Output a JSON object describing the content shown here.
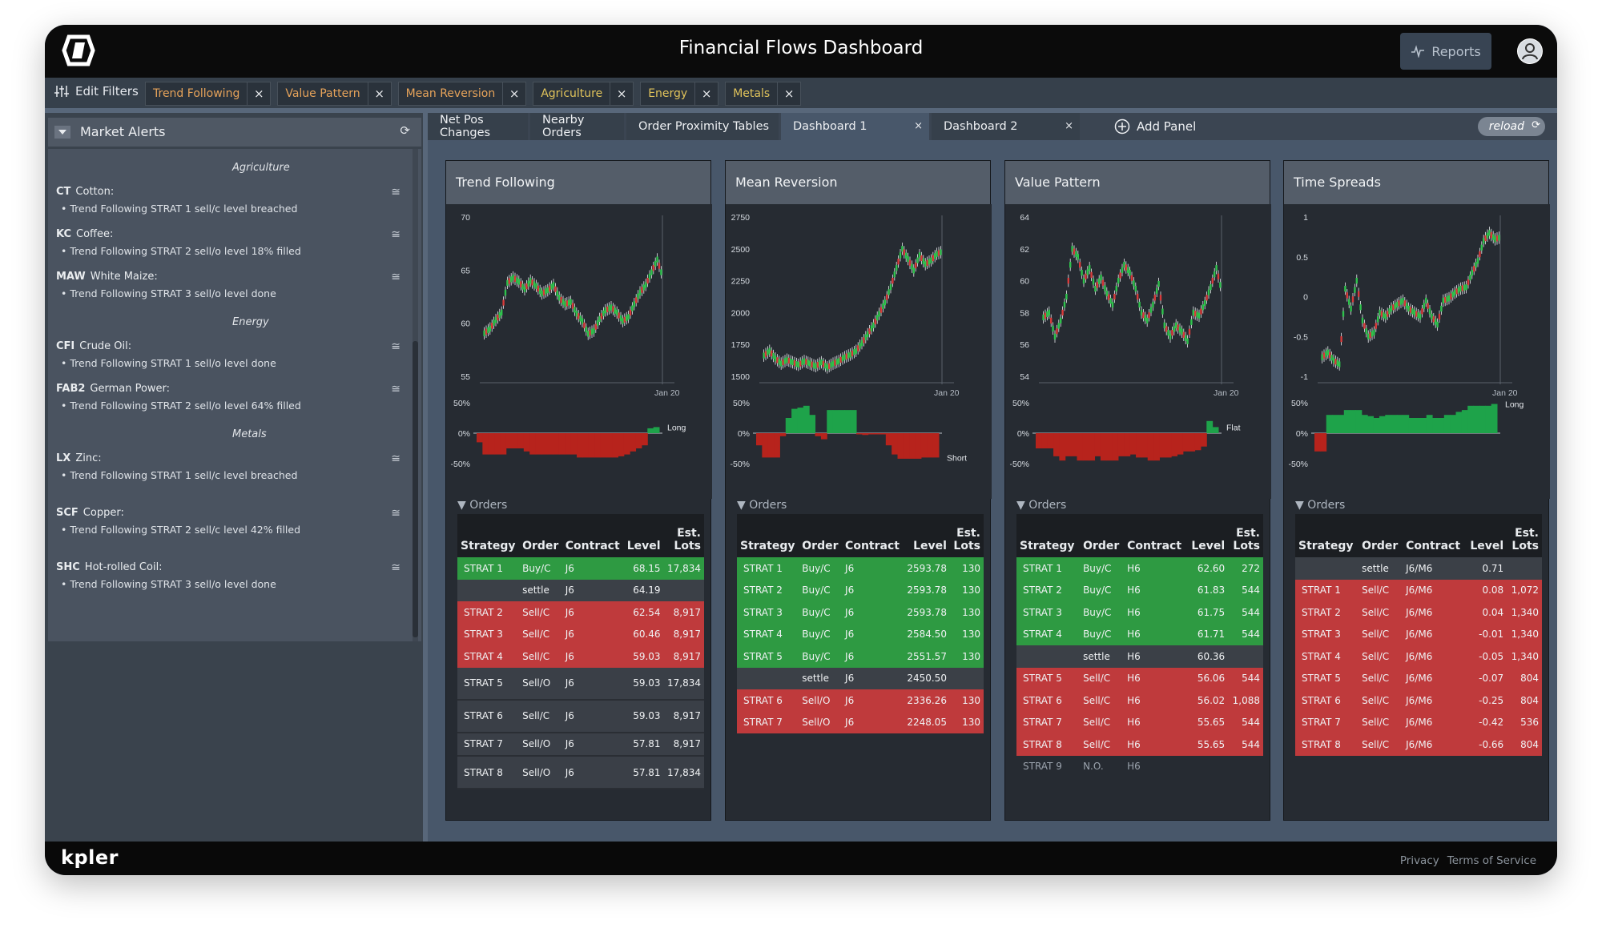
{
  "app": {
    "title": "Financial Flows Dashboard",
    "reports_label": "Reports"
  },
  "filters": {
    "edit_label": "Edit Filters",
    "chips": [
      {
        "label": "Trend Following",
        "color": "#e6a35a"
      },
      {
        "label": "Value Pattern",
        "color": "#e6a35a"
      },
      {
        "label": "Mean Reversion",
        "color": "#e6a35a"
      },
      {
        "label": "Agriculture",
        "color": "#e0c35b"
      },
      {
        "label": "Energy",
        "color": "#e0c35b"
      },
      {
        "label": "Metals",
        "color": "#e0c35b"
      }
    ],
    "remove_symbol": "×"
  },
  "sidebar": {
    "title": "Market Alerts",
    "sections": [
      {
        "name": "Agriculture",
        "alerts": [
          {
            "code": "CT",
            "name": "Cotton:",
            "msg": "Trend Following STRAT 1 sell/c level breached"
          },
          {
            "code": "KC",
            "name": "Coffee:",
            "msg": "Trend Following STRAT 2 sell/o level 18% filled"
          },
          {
            "code": "MAW",
            "name": "White Maize:",
            "msg": "Trend Following STRAT 3 sell/o level done"
          }
        ]
      },
      {
        "name": "Energy",
        "alerts": [
          {
            "code": "CFI",
            "name": "Crude Oil:",
            "msg": "Trend Following STRAT 1 sell/o level done"
          },
          {
            "code": "FAB2",
            "name": "German Power:",
            "msg": "Trend Following STRAT 2 sell/o level 64% filled"
          }
        ]
      },
      {
        "name": "Metals",
        "alerts": [
          {
            "code": "LX",
            "name": "Zinc:",
            "msg": "Trend Following STRAT 1 sell/c level breached"
          },
          {
            "code": "SCF",
            "name": "Copper:",
            "msg": "Trend Following STRAT 2 sell/c level 42% filled"
          },
          {
            "code": "SHC",
            "name": "Hot-rolled Coil:",
            "msg": "Trend Following STRAT 3 sell/o level done"
          }
        ]
      }
    ]
  },
  "tabs": {
    "items": [
      "Net Pos Changes",
      "Nearby Orders",
      "Order Proximity Tables",
      "Dashboard 1",
      "Dashboard 2"
    ],
    "active": "Dashboard 1",
    "add_label": "Add Panel",
    "reload_label": "reload"
  },
  "columns": {
    "strategy": "Strategy",
    "order": "Order",
    "contract": "Contract",
    "level": "Level",
    "lots_top": "Est.",
    "lots_bottom": "Lots"
  },
  "orders_label": "Orders",
  "panels": [
    {
      "title": "Trend Following",
      "chart": {
        "y_ticks": [
          "70",
          "65",
          "60",
          "55"
        ],
        "y_min": 55,
        "y_max": 70,
        "date_label": "Jan 20"
      },
      "position": {
        "ticks": [
          "50%",
          "0%",
          "-50%"
        ],
        "label": "Long"
      },
      "orders": [
        {
          "strategy": "STRAT 1",
          "order": "Buy/C",
          "contract": "J6",
          "level": "68.15",
          "lots": "17,834",
          "type": "buy"
        },
        {
          "strategy": "",
          "order": "settle",
          "contract": "J6",
          "level": "64.19",
          "lots": "",
          "type": "settle"
        },
        {
          "strategy": "STRAT 2",
          "order": "Sell/C",
          "contract": "J6",
          "level": "62.54",
          "lots": "8,917",
          "type": "sell"
        },
        {
          "strategy": "STRAT 3",
          "order": "Sell/C",
          "contract": "J6",
          "level": "60.46",
          "lots": "8,917",
          "type": "sell"
        },
        {
          "strategy": "STRAT 4",
          "order": "Sell/C",
          "contract": "J6",
          "level": "59.03",
          "lots": "8,917",
          "type": "sell"
        },
        {
          "strategy": "STRAT 5",
          "order": "Sell/O",
          "contract": "J6",
          "level": "59.03",
          "lots": "17,834",
          "type": "dark-tall"
        },
        {
          "strategy": "STRAT 6",
          "order": "Sell/C",
          "contract": "J6",
          "level": "59.03",
          "lots": "8,917",
          "type": "dark-tall"
        },
        {
          "strategy": "STRAT 7",
          "order": "Sell/O",
          "contract": "J6",
          "level": "57.81",
          "lots": "8,917",
          "type": "dark"
        },
        {
          "strategy": "STRAT 8",
          "order": "Sell/O",
          "contract": "J6",
          "level": "57.81",
          "lots": "17,834",
          "type": "dark-tall"
        }
      ]
    },
    {
      "title": "Mean Reversion",
      "chart": {
        "y_ticks": [
          "2750",
          "2500",
          "2250",
          "2000",
          "1750",
          "1500"
        ],
        "y_min": 1500,
        "y_max": 2750,
        "date_label": "Jan 20"
      },
      "position": {
        "ticks": [
          "50%",
          "0%",
          "-50%"
        ],
        "label": "Short"
      },
      "orders": [
        {
          "strategy": "STRAT 1",
          "order": "Buy/C",
          "contract": "J6",
          "level": "2593.78",
          "lots": "130",
          "type": "buy"
        },
        {
          "strategy": "STRAT 2",
          "order": "Buy/C",
          "contract": "J6",
          "level": "2593.78",
          "lots": "130",
          "type": "buy"
        },
        {
          "strategy": "STRAT 3",
          "order": "Buy/C",
          "contract": "J6",
          "level": "2593.78",
          "lots": "130",
          "type": "buy"
        },
        {
          "strategy": "STRAT 4",
          "order": "Buy/C",
          "contract": "J6",
          "level": "2584.50",
          "lots": "130",
          "type": "buy"
        },
        {
          "strategy": "STRAT 5",
          "order": "Buy/C",
          "contract": "J6",
          "level": "2551.57",
          "lots": "130",
          "type": "buy"
        },
        {
          "strategy": "",
          "order": "settle",
          "contract": "J6",
          "level": "2450.50",
          "lots": "",
          "type": "settle"
        },
        {
          "strategy": "STRAT 6",
          "order": "Sell/O",
          "contract": "J6",
          "level": "2336.26",
          "lots": "130",
          "type": "sell"
        },
        {
          "strategy": "STRAT 7",
          "order": "Sell/O",
          "contract": "J6",
          "level": "2248.05",
          "lots": "130",
          "type": "sell"
        }
      ]
    },
    {
      "title": "Value Pattern",
      "chart": {
        "y_ticks": [
          "64",
          "62",
          "60",
          "58",
          "56",
          "54"
        ],
        "y_min": 54,
        "y_max": 64,
        "date_label": "Jan 20"
      },
      "position": {
        "ticks": [
          "50%",
          "0%",
          "-50%"
        ],
        "label": "Flat"
      },
      "orders": [
        {
          "strategy": "STRAT 1",
          "order": "Buy/C",
          "contract": "H6",
          "level": "62.60",
          "lots": "272",
          "type": "buy"
        },
        {
          "strategy": "STRAT 2",
          "order": "Buy/C",
          "contract": "H6",
          "level": "61.83",
          "lots": "544",
          "type": "buy"
        },
        {
          "strategy": "STRAT 3",
          "order": "Buy/C",
          "contract": "H6",
          "level": "61.75",
          "lots": "544",
          "type": "buy"
        },
        {
          "strategy": "STRAT 4",
          "order": "Buy/C",
          "contract": "H6",
          "level": "61.71",
          "lots": "544",
          "type": "buy"
        },
        {
          "strategy": "",
          "order": "settle",
          "contract": "H6",
          "level": "60.36",
          "lots": "",
          "type": "settle"
        },
        {
          "strategy": "STRAT 5",
          "order": "Sell/C",
          "contract": "H6",
          "level": "56.06",
          "lots": "544",
          "type": "sell"
        },
        {
          "strategy": "STRAT 6",
          "order": "Sell/C",
          "contract": "H6",
          "level": "56.02",
          "lots": "1,088",
          "type": "sell"
        },
        {
          "strategy": "STRAT 7",
          "order": "Sell/C",
          "contract": "H6",
          "level": "55.65",
          "lots": "544",
          "type": "sell"
        },
        {
          "strategy": "STRAT 8",
          "order": "Sell/C",
          "contract": "H6",
          "level": "55.65",
          "lots": "544",
          "type": "sell"
        },
        {
          "strategy": "STRAT 9",
          "order": "N.O.",
          "contract": "H6",
          "level": "",
          "lots": "",
          "type": "plain"
        }
      ]
    },
    {
      "title": "Time Spreads",
      "chart": {
        "y_ticks": [
          "1",
          "0.5",
          "0",
          "-0.5",
          "-1"
        ],
        "y_min": -1,
        "y_max": 1,
        "date_label": "Jan 20"
      },
      "position": {
        "ticks": [
          "50%",
          "0%",
          "-50%"
        ],
        "label": "Long"
      },
      "orders": [
        {
          "strategy": "",
          "order": "settle",
          "contract": "J6/M6",
          "level": "0.71",
          "lots": "",
          "type": "settle"
        },
        {
          "strategy": "STRAT 1",
          "order": "Sell/C",
          "contract": "J6/M6",
          "level": "0.08",
          "lots": "1,072",
          "type": "sell"
        },
        {
          "strategy": "STRAT 2",
          "order": "Sell/C",
          "contract": "J6/M6",
          "level": "0.04",
          "lots": "1,340",
          "type": "sell"
        },
        {
          "strategy": "STRAT 3",
          "order": "Sell/C",
          "contract": "J6/M6",
          "level": "-0.01",
          "lots": "1,340",
          "type": "sell"
        },
        {
          "strategy": "STRAT 4",
          "order": "Sell/C",
          "contract": "J6/M6",
          "level": "-0.05",
          "lots": "1,340",
          "type": "sell"
        },
        {
          "strategy": "STRAT 5",
          "order": "Sell/C",
          "contract": "J6/M6",
          "level": "-0.07",
          "lots": "804",
          "type": "sell"
        },
        {
          "strategy": "STRAT 6",
          "order": "Sell/C",
          "contract": "J6/M6",
          "level": "-0.25",
          "lots": "804",
          "type": "sell"
        },
        {
          "strategy": "STRAT 7",
          "order": "Sell/C",
          "contract": "J6/M6",
          "level": "-0.42",
          "lots": "536",
          "type": "sell"
        },
        {
          "strategy": "STRAT 8",
          "order": "Sell/C",
          "contract": "J6/M6",
          "level": "-0.66",
          "lots": "804",
          "type": "sell"
        }
      ]
    }
  ],
  "chart_data": [
    {
      "type": "line",
      "title": "Trend Following",
      "x_label": "Jan 20",
      "ylim": [
        55,
        70
      ],
      "series": [
        {
          "values": [
            59.5,
            60.3,
            61.0,
            63.8,
            64.3,
            63.9,
            63.2,
            64.0,
            63.5,
            62.8,
            63.1,
            63.6,
            62.4,
            61.8,
            62.0,
            60.9,
            60.2,
            59.0,
            59.3,
            60.4,
            61.2,
            61.5,
            61.0,
            60.2,
            60.6,
            61.8,
            62.9,
            63.6,
            64.8,
            66.0,
            64.2
          ]
        }
      ],
      "position_series": [
        -15,
        -35,
        -35,
        -35,
        -35,
        -25,
        -25,
        -25,
        -30,
        -35,
        -35,
        -35,
        -35,
        -35,
        -35,
        -35,
        -35,
        -40,
        -40,
        -40,
        -40,
        -40,
        -40,
        -40,
        -38,
        -35,
        -30,
        -25,
        -20,
        8,
        10
      ],
      "ylim_position": [
        -50,
        50
      ]
    },
    {
      "type": "line",
      "title": "Mean Reversion",
      "x_label": "Jan 20",
      "ylim": [
        1500,
        2750
      ],
      "series": [
        {
          "values": [
            1700,
            1640,
            1600,
            1630,
            1610,
            1590,
            1620,
            1600,
            1580,
            1610,
            1570,
            1600,
            1620,
            1650,
            1670,
            1700,
            1760,
            1830,
            1900,
            1990,
            2080,
            2200,
            2350,
            2500,
            2420,
            2330,
            2450,
            2380,
            2410,
            2460,
            2480
          ]
        }
      ],
      "position_series": [
        -20,
        -40,
        -40,
        -40,
        -5,
        25,
        40,
        42,
        45,
        30,
        -5,
        -10,
        38,
        38,
        38,
        38,
        38,
        -2,
        -3,
        -2,
        -2,
        -2,
        -20,
        -35,
        -42,
        -42,
        -42,
        -42,
        -40,
        -40,
        -40
      ],
      "ylim_position": [
        -50,
        50
      ]
    },
    {
      "type": "line",
      "title": "Value Pattern",
      "x_label": "Jan 20",
      "ylim": [
        54,
        64
      ],
      "series": [
        {
          "values": [
            58.0,
            56.5,
            57.5,
            59.0,
            62.0,
            61.5,
            60.0,
            60.8,
            59.5,
            60.2,
            59.2,
            58.5,
            60.0,
            61.0,
            60.5,
            59.5,
            58.0,
            57.5,
            58.5,
            59.8,
            57.2,
            56.5,
            57.2,
            56.8,
            56.2,
            58.0,
            57.8,
            58.6,
            59.6,
            60.8,
            59.2
          ]
        }
      ],
      "position_series": [
        -25,
        -25,
        -25,
        -38,
        -45,
        -38,
        -38,
        -45,
        -45,
        -45,
        -38,
        -45,
        -45,
        -45,
        -38,
        -38,
        -35,
        -40,
        -40,
        -45,
        -45,
        -40,
        -40,
        -38,
        -35,
        -30,
        -30,
        -28,
        -22,
        20,
        10
      ],
      "ylim_position": [
        -50,
        50
      ]
    },
    {
      "type": "line",
      "title": "Time Spreads",
      "x_label": "Jan 20",
      "ylim": [
        -1,
        1
      ],
      "series": [
        {
          "values": [
            -0.7,
            -0.8,
            -0.85,
            0.1,
            -0.15,
            0.2,
            -0.3,
            -0.5,
            -0.45,
            -0.2,
            -0.25,
            -0.15,
            -0.1,
            -0.05,
            -0.15,
            -0.2,
            -0.25,
            -0.05,
            -0.25,
            -0.35,
            -0.05,
            -0.02,
            0.05,
            0.1,
            0.12,
            0.3,
            0.45,
            0.7,
            0.8,
            0.72,
            0.75
          ]
        }
      ],
      "position_series": [
        -30,
        -30,
        30,
        30,
        30,
        38,
        38,
        38,
        30,
        28,
        25,
        28,
        30,
        30,
        30,
        30,
        25,
        25,
        25,
        30,
        25,
        25,
        30,
        30,
        35,
        38,
        45,
        45,
        45,
        45,
        48
      ],
      "ylim_position": [
        -50,
        50
      ]
    }
  ]
}
